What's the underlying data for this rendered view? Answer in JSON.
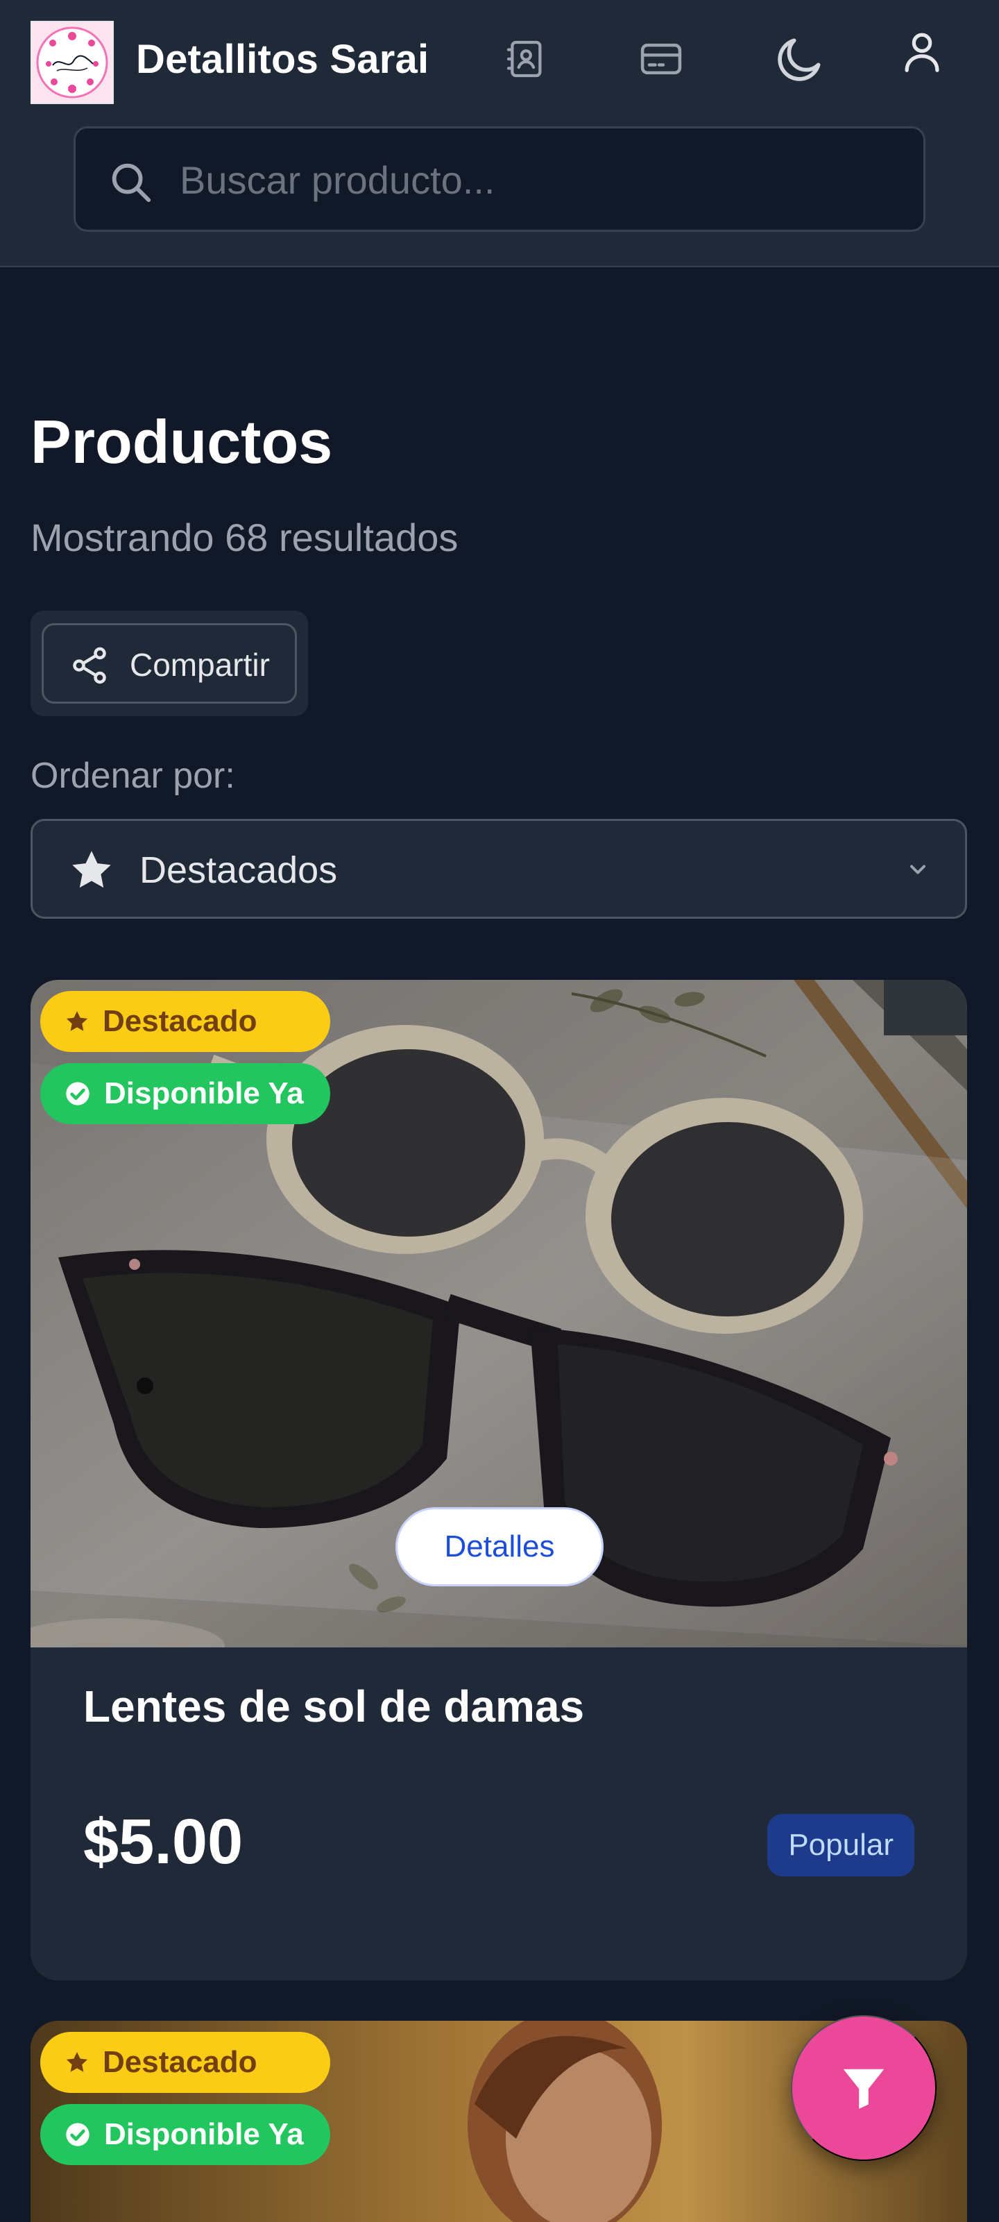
{
  "header": {
    "brand": "Detallitos Sarai",
    "logo_text": "Detallitos Sarai",
    "icons": [
      "contacts-icon",
      "credit-card-icon",
      "moon-icon",
      "user-icon"
    ]
  },
  "search": {
    "placeholder": "Buscar producto...",
    "value": ""
  },
  "main": {
    "title": "Productos",
    "subtitle": "Mostrando 68 resultados",
    "share_label": "Compartir",
    "sort_label": "Ordenar por:",
    "sort_selected": "Destacados"
  },
  "products": [
    {
      "name": "Lentes de sol de damas",
      "price": "$5.00",
      "tag": "Popular",
      "badges": [
        "Destacado",
        "Disponible Ya"
      ],
      "action": "Detalles"
    },
    {
      "badges": [
        "Destacado",
        "Disponible Ya"
      ]
    }
  ],
  "colors": {
    "background": "#111827",
    "header": "#1f2937",
    "card": "#1f2937",
    "featured": "#facc15",
    "available": "#22c55e",
    "fab": "#ec4899",
    "tag": "#1e3a8a"
  },
  "fab": {
    "icon": "filter-icon"
  }
}
